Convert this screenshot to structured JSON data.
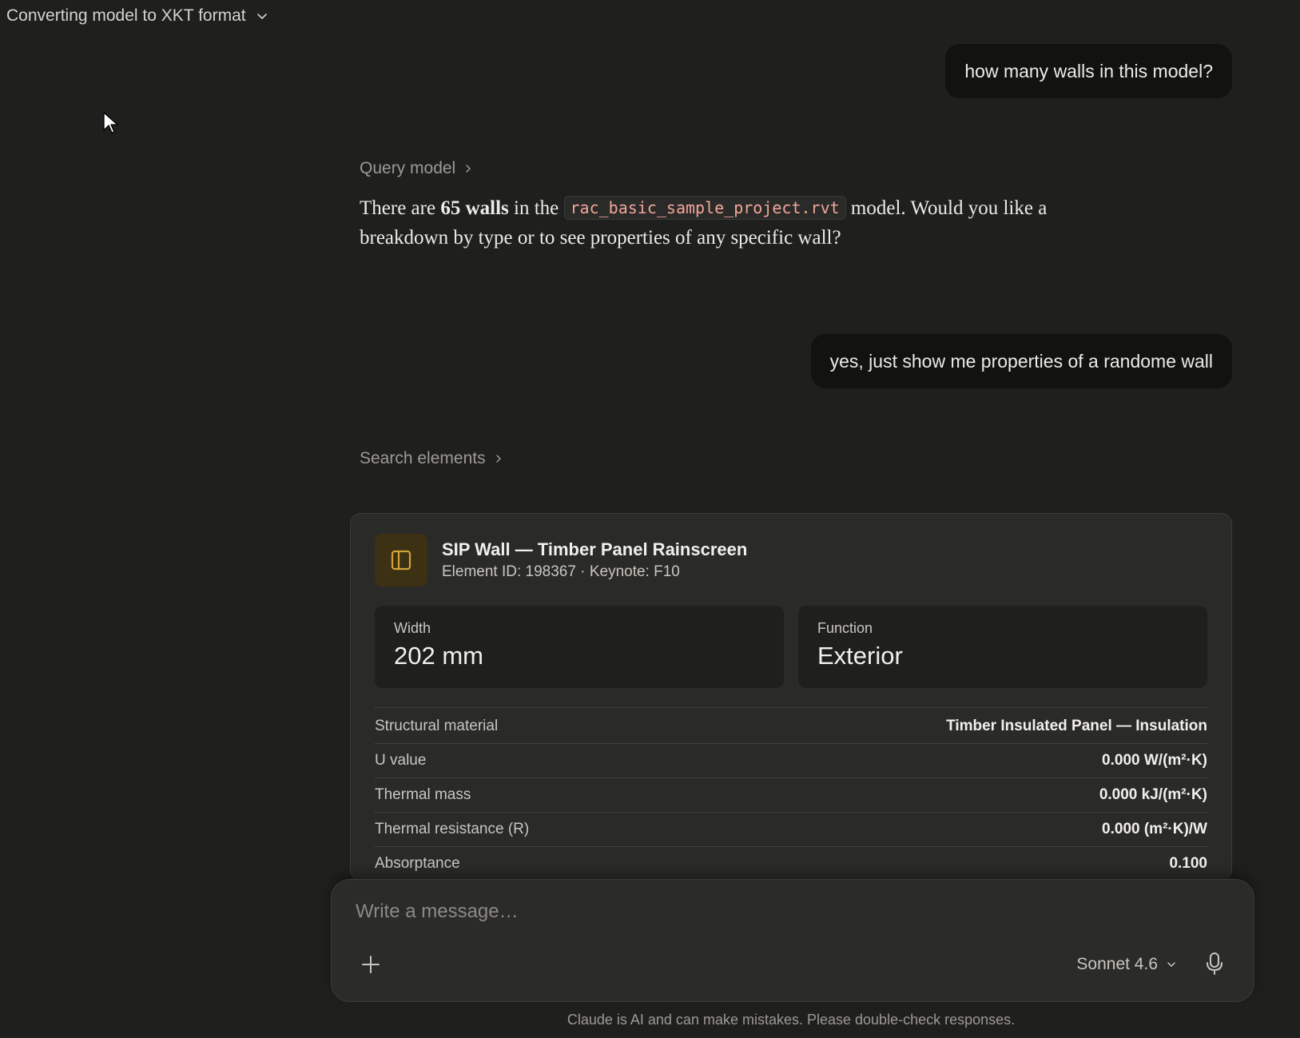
{
  "header": {
    "title": "Converting model to XKT format"
  },
  "messages": {
    "user_1": "how many walls in this model?",
    "tool_1": "Query model",
    "assistant_1": {
      "prefix": "There are ",
      "bold": "65 walls",
      "mid": " in the ",
      "code": "rac_basic_sample_project.rvt",
      "suffix": " model. Would you like a breakdown by type or to see properties of any specific wall?"
    },
    "user_2": "yes, just show me properties of a randome wall",
    "tool_2": "Search elements"
  },
  "card": {
    "title": "SIP Wall — Timber Panel Rainscreen",
    "subtitle": "Element ID: 198367 · Keynote: F10",
    "icon": "panel-icon",
    "accent": "#d3a33a",
    "stats": [
      {
        "label": "Width",
        "value": "202 mm"
      },
      {
        "label": "Function",
        "value": "Exterior"
      }
    ],
    "properties": [
      {
        "name": "Structural material",
        "value": "Timber Insulated Panel — Insulation"
      },
      {
        "name": "U value",
        "value": "0.000 W/(m²·K)"
      },
      {
        "name": "Thermal mass",
        "value": "0.000 kJ/(m²·K)"
      },
      {
        "name": "Thermal resistance (R)",
        "value": "0.000 (m²·K)/W"
      },
      {
        "name": "Absorptance",
        "value": "0.100"
      }
    ]
  },
  "composer": {
    "placeholder": "Write a message…",
    "model": "Sonnet 4.6"
  },
  "disclaimer": "Claude is AI and can make mistakes. Please double-check responses."
}
